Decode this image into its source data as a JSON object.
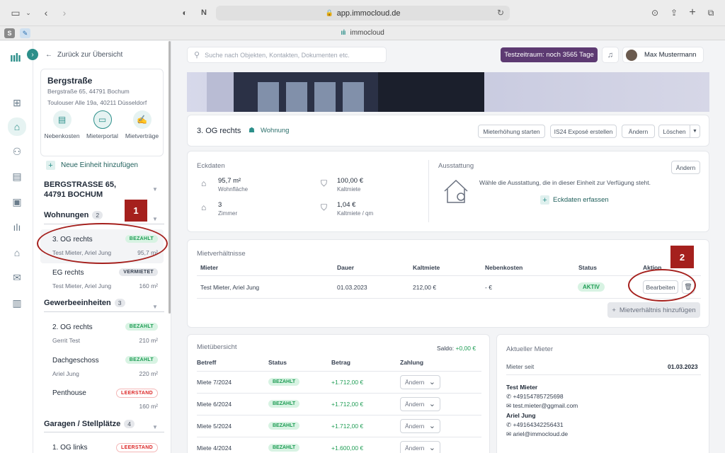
{
  "browser": {
    "url": "app.immocloud.de",
    "tab_title": "immocloud",
    "ext_s": "S"
  },
  "search": {
    "placeholder": "Suche nach Objekten, Kontakten, Dokumenten etc."
  },
  "header": {
    "trial": "Testzeitraum: noch 3565 Tage",
    "user_name": "Max Mustermann"
  },
  "sidebar": {
    "back": "Zurück zur Übersicht",
    "property": {
      "name": "Bergstraße",
      "address1": "Bergstraße 65, 44791 Bochum",
      "address2": "Toulouser Alle 19a, 40211 Düsseldorf",
      "actions": [
        "Nebenkosten",
        "Mieterportal",
        "Mietverträge"
      ]
    },
    "add_unit": "Neue Einheit hinzufügen",
    "building": "BERGSTRASSE 65, 44791 BOCHUM",
    "groups": {
      "wohnungen": {
        "label": "Wohnungen",
        "count": "2"
      },
      "gewerbe": {
        "label": "Gewerbeeinheiten",
        "count": "3"
      },
      "garagen": {
        "label": "Garagen / Stellplätze",
        "count": "4"
      }
    },
    "units": [
      {
        "name": "3. OG rechts",
        "tenant": "Test Mieter, Ariel Jung",
        "area": "95,7 m²",
        "badge": "BEZAHLT"
      },
      {
        "name": "EG rechts",
        "tenant": "Test Mieter, Ariel Jung",
        "area": "160 m²",
        "badge": "VERMIETET"
      },
      {
        "name": "2. OG rechts",
        "tenant": "Gerrit Test",
        "area": "210 m²",
        "badge": "BEZAHLT"
      },
      {
        "name": "Dachgeschoss",
        "tenant": "Ariel Jung",
        "area": "220 m²",
        "badge": "BEZAHLT"
      },
      {
        "name": "Penthouse",
        "tenant": "",
        "area": "160 m²",
        "badge": "LEERSTAND"
      },
      {
        "name": "1. OG links",
        "tenant": "",
        "area": "",
        "badge": "LEERSTAND"
      }
    ]
  },
  "unit_header": {
    "name": "3. OG rechts",
    "type": "Wohnung",
    "buttons": {
      "increase": "Mieterhöhung starten",
      "expose": "IS24 Exposé erstellen",
      "edit": "Ändern",
      "delete": "Löschen"
    }
  },
  "eckdaten": {
    "title": "Eckdaten",
    "items": [
      {
        "value": "95,7 m²",
        "label": "Wohnfläche"
      },
      {
        "value": "100,00 €",
        "label": "Kaltmiete"
      },
      {
        "value": "3",
        "label": "Zimmer"
      },
      {
        "value": "1,04 €",
        "label": "Kaltmiete / qm"
      }
    ]
  },
  "ausstattung": {
    "title": "Ausstattung",
    "edit": "Ändern",
    "text": "Wähle die Ausstattung, die in dieser Einheit zur Verfügung steht.",
    "add": "Eckdaten erfassen"
  },
  "mietverhaeltnisse": {
    "title": "Mietverhältnisse",
    "headers": [
      "Mieter",
      "Dauer",
      "Kaltmiete",
      "Nebenkosten",
      "Status",
      "Aktion"
    ],
    "row": {
      "tenant": "Test Mieter, Ariel Jung",
      "date": "01.03.2023",
      "rent": "212,00 €",
      "costs": "- €",
      "status": "AKTIV",
      "action": "Bearbeiten"
    },
    "add": "Mietverhältnis hinzufügen"
  },
  "mietuebersicht": {
    "title": "Mietübersicht",
    "saldo_label": "Saldo:",
    "saldo_value": "+0,00 €",
    "headers": [
      "Betreff",
      "Status",
      "Betrag",
      "Zahlung"
    ],
    "rows": [
      {
        "subject": "Miete 7/2024",
        "status": "BEZAHLT",
        "amount": "+1.712,00 €",
        "payment": "Ändern"
      },
      {
        "subject": "Miete 6/2024",
        "status": "BEZAHLT",
        "amount": "+1.712,00 €",
        "payment": "Ändern"
      },
      {
        "subject": "Miete 5/2024",
        "status": "BEZAHLT",
        "amount": "+1.712,00 €",
        "payment": "Ändern"
      },
      {
        "subject": "Miete 4/2024",
        "status": "BEZAHLT",
        "amount": "+1.600,00 €",
        "payment": "Ändern"
      }
    ]
  },
  "aktueller_mieter": {
    "title": "Aktueller Mieter",
    "since_label": "Mieter seit",
    "since_value": "01.03.2023",
    "tenants": [
      {
        "name": "Test Mieter",
        "phone": "+49154785725698",
        "email": "test.mieter@ggmail.com"
      },
      {
        "name": "Ariel Jung",
        "phone": "+49164342256431",
        "email": "ariel@immocloud.de"
      }
    ]
  },
  "annotations": {
    "one": "1",
    "two": "2"
  },
  "colors": {
    "accent": "#2c8f8a",
    "trial": "#5d3a72",
    "annotation": "#a5201d",
    "paid": "#1f9d55"
  }
}
